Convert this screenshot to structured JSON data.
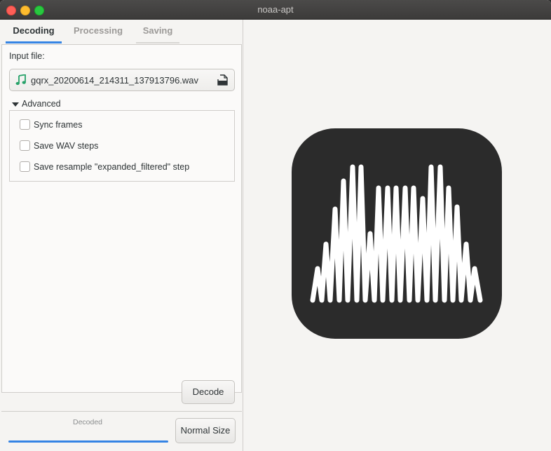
{
  "window": {
    "title": "noaa-apt"
  },
  "tabs": [
    {
      "label": "Decoding",
      "active": true
    },
    {
      "label": "Processing",
      "active": false
    },
    {
      "label": "Saving",
      "active": false
    }
  ],
  "decoding": {
    "input_label": "Input file:",
    "file_name": "gqrx_20200614_214311_137913796.wav",
    "file_icon": "music-note-icon",
    "open_icon": "document-open-icon",
    "advanced_label": "Advanced",
    "options": [
      {
        "label": "Sync frames",
        "checked": false
      },
      {
        "label": "Save WAV steps",
        "checked": false
      },
      {
        "label": "Save resample \"expanded_filtered\" step",
        "checked": false
      }
    ],
    "decode_label": "Decode"
  },
  "status": {
    "text": "Decoded",
    "progress": 1.0,
    "normal_size_label": "Normal Size"
  },
  "colors": {
    "accent": "#3584e4",
    "logo_bg": "#2b2b2b",
    "music_icon": "#26a269"
  }
}
